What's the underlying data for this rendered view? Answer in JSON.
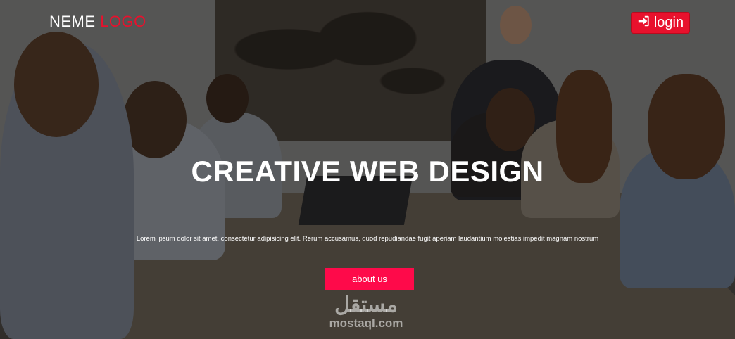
{
  "brand": {
    "name": "NEME",
    "accent": "LOGO",
    "accent_color": "#e8112d"
  },
  "header": {
    "login_label": "login",
    "login_icon": "sign-in-icon"
  },
  "hero": {
    "title": "CREATIVE WEB DESIGN",
    "subtitle": "Lorem ipsum dolor sit amet, consectetur adipisicing elit. Rerum accusamus, quod repudiandae fugit aperiam laudantium molestias impedit magnam nostrum",
    "cta_label": "about us",
    "cta_color": "#fe0a4a"
  },
  "watermark": {
    "arabic": "مستقل",
    "latin": "mostaql.com"
  }
}
